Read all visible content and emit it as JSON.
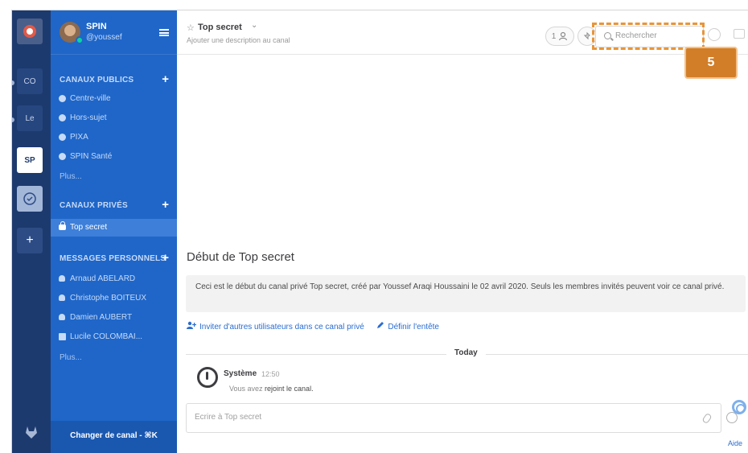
{
  "team_rail": {
    "teams": [
      {
        "label": "",
        "kind": "logo"
      },
      {
        "label": "CO",
        "kind": "text"
      },
      {
        "label": "Le",
        "kind": "text"
      },
      {
        "label": "SP",
        "kind": "active"
      },
      {
        "label": "",
        "kind": "image"
      },
      {
        "label": "+",
        "kind": "add"
      }
    ],
    "footer_icon": "gitlab-icon"
  },
  "sidebar": {
    "team_name": "SPIN",
    "username": "@youssef",
    "public_channels": {
      "title": "CANAUX PUBLICS",
      "items": [
        "Centre-ville",
        "Hors-sujet",
        "PIXA",
        "SPIN Santé"
      ],
      "more": "Plus..."
    },
    "private_channels": {
      "title": "CANAUX PRIVÉS",
      "items": [
        "Top secret"
      ]
    },
    "direct_messages": {
      "title": "MESSAGES PERSONNELS",
      "items": [
        "Arnaud ABELARD",
        "Christophe BOITEUX",
        "Damien AUBERT",
        "Lucile COLOMBAI..."
      ],
      "more": "Plus..."
    },
    "switch_channel": "Changer de canal - ⌘K"
  },
  "header": {
    "channel_name": "Top secret",
    "description": "Ajouter une description au canal",
    "member_count": "1",
    "search_placeholder": "Rechercher"
  },
  "annotation": {
    "badge": "5",
    "color": "#d27e28"
  },
  "intro": {
    "title": "Début de Top secret",
    "text": "Ceci est le début du canal privé Top secret, créé par Youssef Araqi Houssaini le 02 avril 2020. Seuls les membres invités peuvent voir ce canal privé.",
    "invite_link": "Inviter d'autres utilisateurs dans ce canal privé",
    "header_link": "Définir l'entête"
  },
  "messages": {
    "divider": "Today",
    "author": "Système",
    "time": "12:50",
    "text_prefix": "Vous avez ",
    "text_bold": "rejoint le canal."
  },
  "composer": {
    "placeholder": "Écrire à Top secret"
  },
  "help": "Aide",
  "colors": {
    "sidebar": "#1f66c8",
    "team_rail": "#1d3a6e",
    "link": "#2a6dd2",
    "online": "#06d6a0"
  }
}
